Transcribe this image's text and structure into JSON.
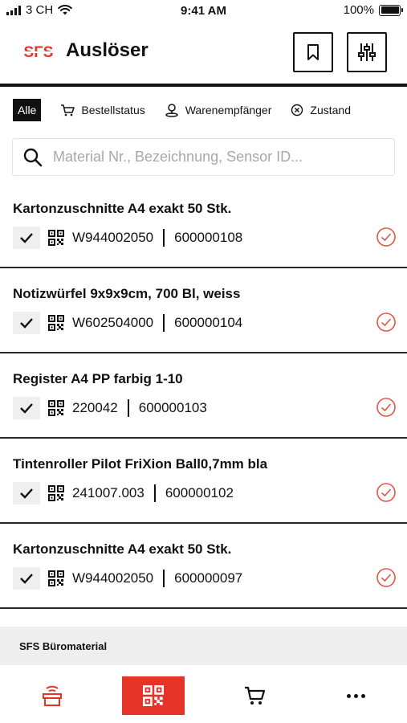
{
  "status_bar": {
    "carrier": "3 CH",
    "time": "9:41 AM",
    "battery": "100%"
  },
  "header": {
    "logo_text": "SFS",
    "title": "Auslöser"
  },
  "filters": {
    "all": "Alle",
    "order_status": "Bestellstatus",
    "recipient": "Warenempfänger",
    "state": "Zustand"
  },
  "search": {
    "placeholder": "Material Nr., Bezeichnung, Sensor ID..."
  },
  "items": [
    {
      "title": "Kartonzuschnitte A4 exakt 50 Stk.",
      "code": "W944002050",
      "id": "600000108"
    },
    {
      "title": "Notizwürfel 9x9x9cm, 700 Bl, weiss",
      "code": "W602504000",
      "id": "600000104"
    },
    {
      "title": "Register A4 PP farbig 1-10",
      "code": "220042",
      "id": "600000103"
    },
    {
      "title": "Tintenroller Pilot FriXion Ball0,7mm bla",
      "code": "241007.003",
      "id": "600000102"
    },
    {
      "title": "Kartonzuschnitte A4 exakt 50 Stk.",
      "code": "W944002050",
      "id": "600000097"
    }
  ],
  "group": {
    "title": "SFS Büromaterial"
  },
  "colors": {
    "brand_red": "#e63329",
    "text": "#111111",
    "status_check": "#e05548"
  },
  "icons": {
    "bookmark": "bookmark-icon",
    "filter": "sliders-icon",
    "search": "search-icon",
    "cart": "cart-icon",
    "recipient": "location-pin-icon",
    "state": "circle-x-icon",
    "row_check": "checkmark-icon",
    "row_qr": "qr-code-icon",
    "row_status": "circle-check-icon",
    "nav_1": "sensor-box-icon",
    "nav_2": "qr-code-icon",
    "nav_3": "cart-icon",
    "nav_4": "more-dots-icon"
  }
}
